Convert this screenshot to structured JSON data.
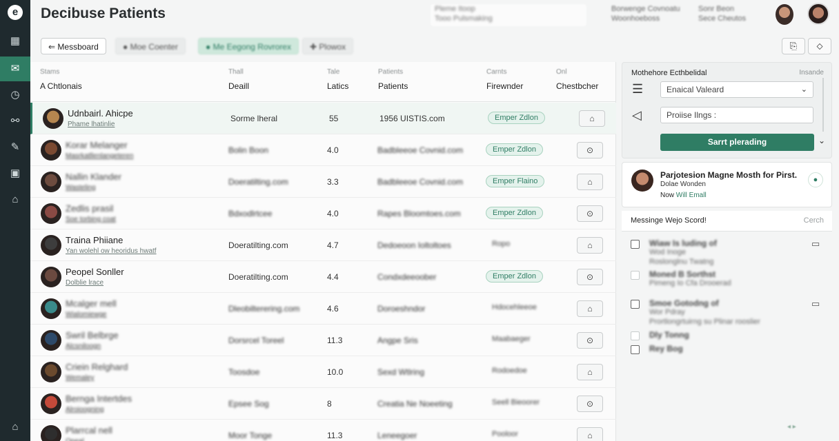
{
  "app": {
    "logo": "e",
    "title": "Decibuse Patients"
  },
  "sidebar": {
    "items": [
      {
        "icon": "grid-icon",
        "glyph": "▦"
      },
      {
        "icon": "inbox-icon",
        "glyph": "✉"
      },
      {
        "icon": "clock-icon",
        "glyph": "◷"
      },
      {
        "icon": "link-icon",
        "glyph": "⚯"
      },
      {
        "icon": "pen-icon",
        "glyph": "✎"
      },
      {
        "icon": "card-icon",
        "glyph": "▣"
      },
      {
        "icon": "reports-icon",
        "glyph": "⌂"
      },
      {
        "icon": "home-icon",
        "glyph": "⌂"
      }
    ]
  },
  "header": {
    "search_line1": "Pleme Itoop",
    "search_line2": "Tooo Pulsmaking",
    "info1_line1": "Borwenge Covnoatu",
    "info1_line2": "Woonhoeboss",
    "info2_line1": "Sonr Beon",
    "info2_line2": "Sece Cheutos"
  },
  "toolbar": {
    "back_label": "Messboard",
    "btn2": "Moe Coenter",
    "btn3": "Me Eegong Rovrorex",
    "btn4": "Plowox"
  },
  "table": {
    "columns": [
      {
        "sub": "Stams",
        "main": "A Chtlonais"
      },
      {
        "sub": "Thall",
        "main": "Deaill"
      },
      {
        "sub": "Tale",
        "main": "Latics"
      },
      {
        "sub": "Patients",
        "main": "Patients"
      },
      {
        "sub": "Carnts",
        "main": "Firewnder"
      },
      {
        "sub": "Onl",
        "main": "Chestbcher"
      }
    ],
    "rows": [
      {
        "name": "Udnbairl. Ahicpe",
        "sub": "Phame lhatinlie",
        "c2": "Sorme lheral",
        "c3": "55",
        "c4": "1956 UISTIS.com",
        "badge": "Emper Zdlon",
        "badge_style": "pill",
        "blur": false,
        "av": "#b5864f"
      },
      {
        "name": "Korar Melanger",
        "sub": "Masrkatllenlangeteren",
        "c2": "Bolin Boon",
        "c3": "4.0",
        "c4": "Badbleeoe Covnid.com",
        "badge": "Emper Zdlon",
        "badge_style": "pill",
        "blur": true,
        "av": "#7b4a32"
      },
      {
        "name": "Nallin Klander",
        "sub": "Wasteling",
        "c2": "Doeratilting.com",
        "c3": "3.3",
        "c4": "Badbleeoe Covnid.com",
        "badge": "Emper Flaino",
        "badge_style": "pill",
        "blur": true,
        "av": "#6e4c3f"
      },
      {
        "name": "Zedlis prasil",
        "sub": "Soe torbing coat",
        "c2": "Bdxodlrtcee",
        "c3": "4.0",
        "c4": "Rapes Bloomtoes.com",
        "badge": "Emper Zdlon",
        "badge_style": "pill",
        "blur": true,
        "av": "#8a4a44"
      },
      {
        "name": "Traina Phiiane",
        "sub": "Yan wolehl ow heoridus hwatf",
        "c2": "Doeratilting.com",
        "c3": "4.7",
        "c4": "Dedoeoon Ioltoltoes",
        "badge": "Ropo",
        "badge_style": "plain",
        "blur": false,
        "av": "#3d3d3d"
      },
      {
        "name": "Peopel Sonller",
        "sub": "Dolblie lrace",
        "c2": "Doeratilting.com",
        "c3": "4.4",
        "c4": "Condxdeeoober",
        "badge": "Emper Zdlon",
        "badge_style": "pill",
        "blur": false,
        "av": "#6b4a40"
      },
      {
        "name": "Mcalger mell",
        "sub": "Wialomiewge",
        "c2": "Dleobilterering.com",
        "c3": "4.6",
        "c4": "Doroeshndor",
        "badge": "Hdocehleeoe",
        "badge_style": "plain",
        "blur": true,
        "av": "#3a8a8a"
      },
      {
        "name": "Swril Belbrge",
        "sub": "Alcsniloogn",
        "c2": "Dorsrcel Toreel",
        "c3": "11.3",
        "c4": "Angpe Sris",
        "badge": "Maabaeger",
        "badge_style": "plain",
        "blur": true,
        "av": "#2e4a6a"
      },
      {
        "name": "Criein Relghard",
        "sub": "Wemaley",
        "c2": "Toosdoe",
        "c3": "10.0",
        "c4": "Sexd Wtlring",
        "badge": "Rodoedoe",
        "badge_style": "plain",
        "blur": true,
        "av": "#6b4a2e"
      },
      {
        "name": "Bernga Intertdes",
        "sub": "Alroioogning",
        "c2": "Epsee Sog",
        "c3": "8",
        "c4": "Creatia Ne Noeeting",
        "badge": "Seell Bieoorer",
        "badge_style": "plain",
        "blur": true,
        "av": "#c44a3a"
      },
      {
        "name": "Plarrcal nell",
        "sub": "Qpeal",
        "c2": "Moor Tonge",
        "c3": "11.3",
        "c4": "Leneegoer",
        "badge": "Pooloor",
        "badge_style": "plain",
        "blur": true,
        "av": "#2e2e2e"
      }
    ]
  },
  "form": {
    "title": "Mothehore Ecthbelidal",
    "link": "Insande",
    "select_value": "Enaical Valeard",
    "input_value": "Proiise Ilngs :",
    "submit_label": "Sarrt plerading"
  },
  "user_card": {
    "title": "Parjotesion Magne Mosth for Pirst.",
    "subtitle": "Dolae Wonden",
    "link_prefix": "Now",
    "link": "Will Emall"
  },
  "messages": {
    "title": "Messinge Wejo Scord!",
    "search": "Cerch",
    "items": [
      {
        "t1": "Wiaw Is luding of",
        "t2": "Wod Inoge",
        "t3": "Roslonglnu Twatng"
      },
      {
        "t1": "Moned B Sorthst",
        "t2": "Pimeng Io Cfa Drooerad"
      },
      {
        "t1": "Smoe Gotodng of",
        "t2": "Wor Pdray",
        "t3": "Prortlongrtuirng su Plinar rooslier"
      },
      {
        "t1": "Dly Tonng"
      },
      {
        "t1": "Rey Bog"
      }
    ]
  },
  "colors": {
    "accent": "#2f7d64",
    "sidebar": "#1f2a2e"
  }
}
